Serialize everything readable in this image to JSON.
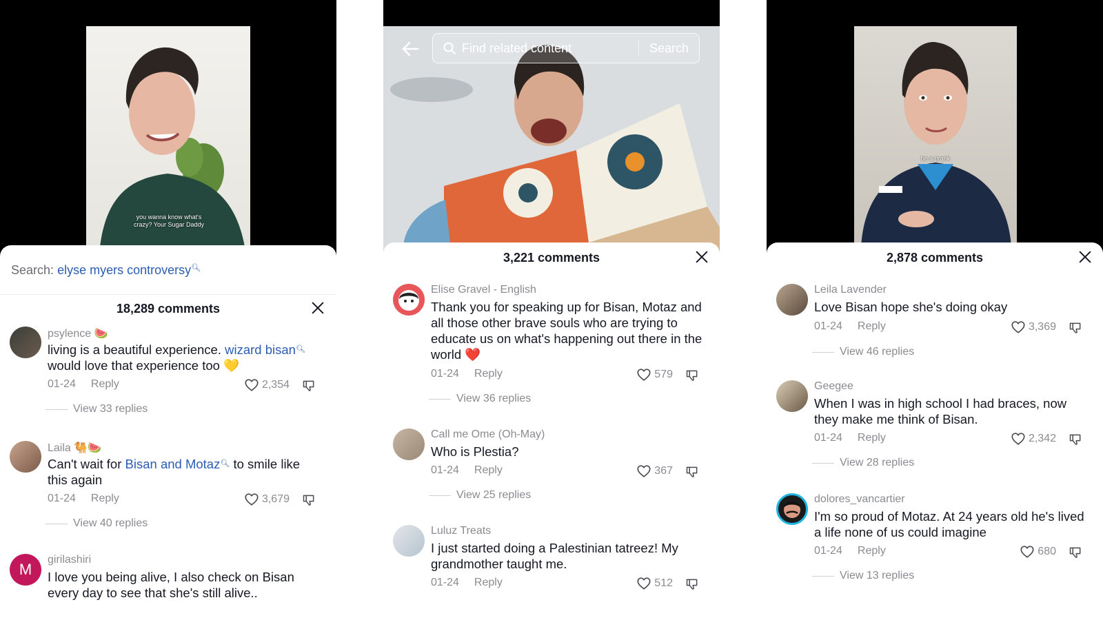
{
  "panel1": {
    "video_caption": "you wanna know what's crazy? Your Sugar Daddy",
    "search_label": "Search:",
    "search_query": "elyse myers controversy",
    "comment_count": "18,289 comments",
    "comments": [
      {
        "user": "psylence 🍉",
        "text_before": "living is a beautiful experience. ",
        "link": "wizard bisan",
        "text_after": " would love that experience too 💛",
        "date": "01-24",
        "reply": "Reply",
        "likes": "2,354",
        "view_replies": "View 33 replies"
      },
      {
        "user": "Laila 🐫🍉",
        "text_before": "Can't wait for ",
        "link": "Bisan and Motaz",
        "text_after": " to smile like this again",
        "date": "01-24",
        "reply": "Reply",
        "likes": "3,679",
        "view_replies": "View 40 replies"
      },
      {
        "user": "girilashiri",
        "avatar_letter": "M",
        "text": "I love you being alive, I also check on Bisan every day to see that she's still alive.."
      }
    ]
  },
  "panel2": {
    "search_placeholder": "Find related content",
    "search_button": "Search",
    "comment_count": "3,221 comments",
    "comments": [
      {
        "user": "Elise Gravel - English",
        "text": "Thank you for speaking up for Bisan, Motaz and all those other brave souls who are trying to educate us on what's happening out there in the world ❤️",
        "date": "01-24",
        "reply": "Reply",
        "likes": "579",
        "view_replies": "View 36 replies"
      },
      {
        "user": "Call me Ome (Oh-May)",
        "text": "Who is Plestia?",
        "date": "01-24",
        "reply": "Reply",
        "likes": "367",
        "view_replies": "View 25 replies"
      },
      {
        "user": "Luluz Treats",
        "text": "I just started doing a Palestinian tatreez! My grandmother taught me.",
        "date": "01-24",
        "reply": "Reply",
        "likes": "512"
      }
    ]
  },
  "panel3": {
    "video_caption": "be a prank",
    "comment_count": "2,878 comments",
    "comments": [
      {
        "user": "Leila Lavender",
        "text": "Love Bisan hope she's doing okay",
        "date": "01-24",
        "reply": "Reply",
        "likes": "3,369",
        "view_replies": "View 46 replies"
      },
      {
        "user": "Geegee",
        "text": "When I was in high school I had braces, now they make me think of Bisan.",
        "date": "01-24",
        "reply": "Reply",
        "likes": "2,342",
        "view_replies": "View 28 replies"
      },
      {
        "user": "dolores_vancartier",
        "text": "I'm so proud of Motaz. At 24 years old he's lived a life none of us could imagine",
        "date": "01-24",
        "reply": "Reply",
        "likes": "680",
        "view_replies": "View 13 replies"
      }
    ]
  },
  "colors": {
    "link": "#2b5db4",
    "muted": "#8a8b91",
    "text": "#161823",
    "avatar_m": "#c2185b"
  },
  "icons": [
    "search-icon",
    "close-icon",
    "heart-icon",
    "dislike-icon",
    "back-arrow-icon"
  ]
}
